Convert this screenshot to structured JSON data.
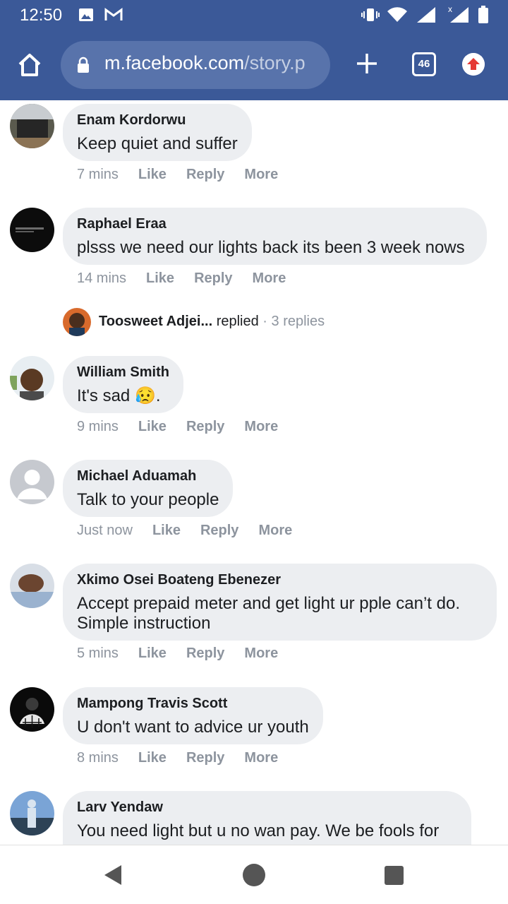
{
  "status_bar": {
    "time": "12:50",
    "icons": [
      "image-icon",
      "gmail-icon",
      "vibrate-icon",
      "wifi-icon",
      "signal-icon",
      "signal-x-icon",
      "battery-icon"
    ]
  },
  "browser": {
    "url_host": "m.facebook.com",
    "url_path": "/story.p",
    "tab_count": "46"
  },
  "comments": [
    {
      "author": "Enam Kordorwu",
      "text": "Keep quiet and suffer",
      "time": "7 mins"
    },
    {
      "author": "Raphael Eraa",
      "text": "plsss we need our lights back its been 3 week nows",
      "time": "14 mins"
    },
    {
      "author": "William Smith",
      "text": "It's sad 😥.",
      "time": "9 mins"
    },
    {
      "author": "Michael Aduamah",
      "text": "Talk to your people",
      "time": "Just now"
    },
    {
      "author": "Xkimo Osei Boateng Ebenezer",
      "text": "Accept prepaid meter and get light ur pple can’t do. Simple instruction",
      "time": "5 mins"
    },
    {
      "author": "Mampong Travis Scott",
      "text": "U don't want to advice ur youth",
      "time": "8 mins"
    },
    {
      "author": "Larv Yendaw",
      "text": "You need light but u no wan pay. We be fools for",
      "time": ""
    }
  ],
  "actions": {
    "like": "Like",
    "reply": "Reply",
    "more": "More"
  },
  "replies_summary": {
    "name": "Toosweet Adjei...",
    "verb": " replied",
    "count": " · 3 replies"
  },
  "colors": {
    "brand": "#3b5998",
    "bubble": "#eceef1",
    "muted": "#8d949e"
  }
}
